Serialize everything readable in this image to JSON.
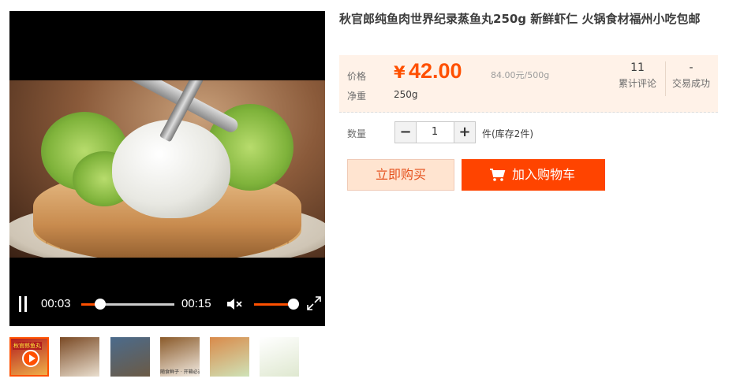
{
  "player": {
    "current_time": "00:03",
    "duration": "00:15",
    "progress": 0.2,
    "volume": 1.0,
    "muted": true
  },
  "thumbnails": [
    {
      "label": "秋官郎鱼丸",
      "video": true,
      "colors": [
        "#b21e1e",
        "#f0b04a"
      ]
    },
    {
      "label": "",
      "colors": [
        "#7a4a25",
        "#eadfcf"
      ]
    },
    {
      "label": "",
      "colors": [
        "#4b6b8c",
        "#6b5a45"
      ]
    },
    {
      "label": "",
      "caption": "随食鲜子 · 开箱必选",
      "colors": [
        "#8a5a2a",
        "#f3ede4"
      ]
    },
    {
      "label": "",
      "colors": [
        "#d98a4a",
        "#cfe3b8"
      ]
    },
    {
      "label": "",
      "colors": [
        "#ffffff",
        "#dfe8d0"
      ]
    }
  ],
  "product": {
    "title": "秋官郎纯鱼肉世界纪录蒸鱼丸250g 新鲜虾仁 火锅食材福州小吃包邮"
  },
  "price_box": {
    "price_label": "价格",
    "currency": "¥",
    "price": "42.00",
    "unit_price": "84.00元/500g",
    "weight_label": "净重",
    "weight": "250g",
    "reviews_count": "11",
    "reviews_label": "累计评论",
    "sales_count": "-",
    "sales_label": "交易成功"
  },
  "quantity": {
    "label": "数量",
    "minus": "−",
    "value": "1",
    "plus": "+",
    "stock": "件(库存2件)"
  },
  "actions": {
    "buy_now": "立即购买",
    "add_to_cart": "加入购物车"
  },
  "colors": {
    "accent": "#ff5000",
    "cart_button": "#ff4400",
    "buy_button_bg": "#ffe4d0",
    "price_box_bg": "#fff2e8"
  }
}
